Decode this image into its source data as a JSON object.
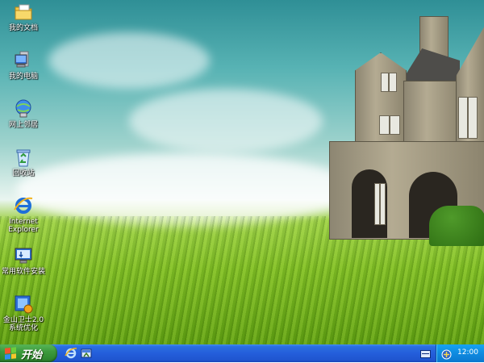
{
  "desktop": {
    "icons": [
      {
        "label": "我的文档",
        "icon": "my-documents-folder-icon"
      },
      {
        "label": "我的电脑",
        "icon": "my-computer-icon"
      },
      {
        "label": "网上邻居",
        "icon": "network-places-icon"
      },
      {
        "label": "回收站",
        "icon": "recycle-bin-icon"
      },
      {
        "label": "Internet\nExplorer",
        "icon": "internet-explorer-icon"
      },
      {
        "label": "常用软件安装",
        "icon": "software-install-icon"
      },
      {
        "label": "金山卫士2.0\n系统优化",
        "icon": "security-suite-icon"
      }
    ]
  },
  "taskbar": {
    "start_label": "开始",
    "quick_launch": [
      "internet-explorer-icon",
      "show-desktop-icon"
    ],
    "tray": {
      "clock": "12:00"
    }
  },
  "colors": {
    "taskbar_blue": "#245edb",
    "start_green": "#3c9a3c",
    "tray_blue": "#0f8be0"
  }
}
